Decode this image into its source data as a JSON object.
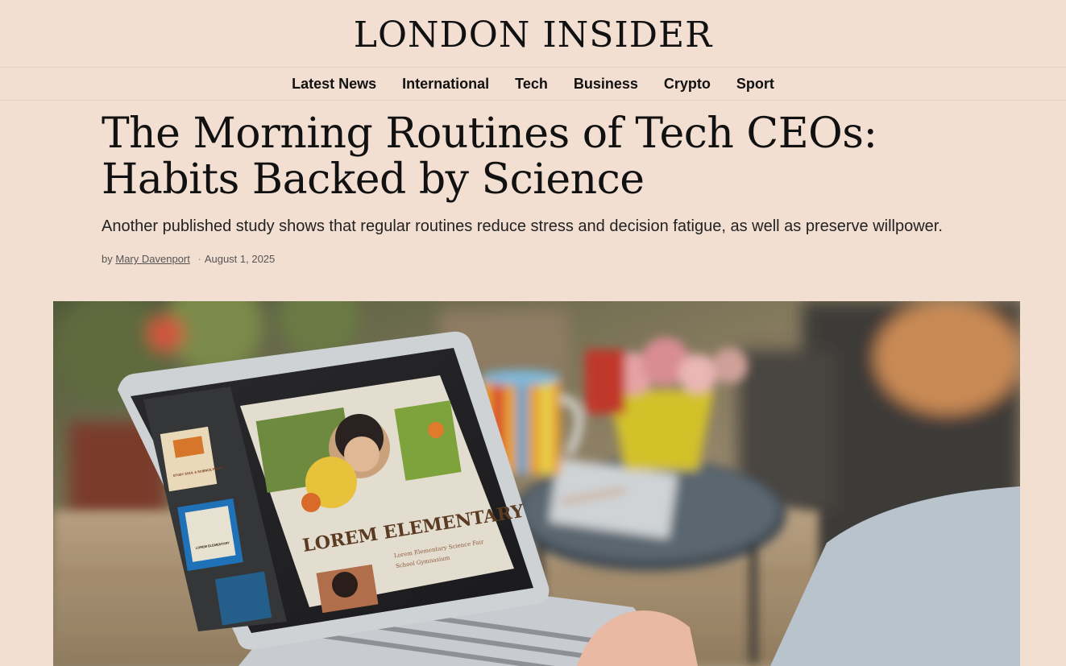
{
  "site": {
    "name": "LONDON INSIDER"
  },
  "nav": {
    "items": [
      {
        "label": "Latest News"
      },
      {
        "label": "International"
      },
      {
        "label": "Tech"
      },
      {
        "label": "Business"
      },
      {
        "label": "Crypto"
      },
      {
        "label": "Sport"
      }
    ]
  },
  "article": {
    "headline": "The Morning Routines of Tech CEOs: Habits Backed by Science",
    "standfirst": "Another published study shows that regular routines reduce stress and decision fatigue, as well as preserve willpower.",
    "byline_prefix": "by",
    "author": "Mary Davenport",
    "separator": "·",
    "date": "August 1, 2025"
  },
  "hero_image": {
    "screen_title": "LOREM ELEMENTARY",
    "screen_caption_1": "Lorem Elementary Science Fair",
    "screen_caption_2": "School Gymnasium",
    "thumb_1": "STUDY SOUL & SCIENCE PARTY",
    "thumb_2": "LOREM ELEMENTARY"
  }
}
